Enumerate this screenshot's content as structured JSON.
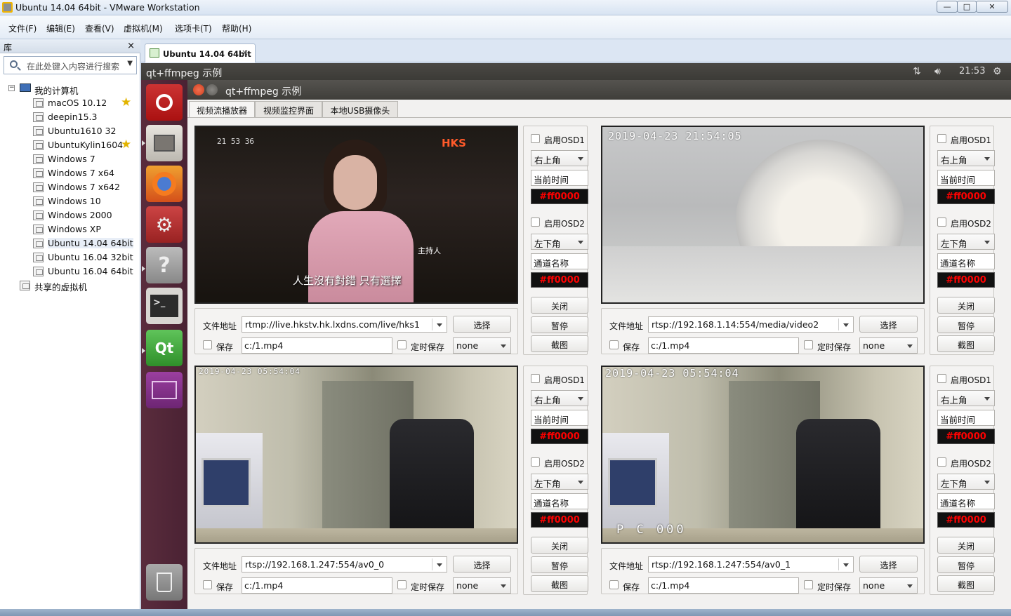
{
  "window": {
    "title": "Ubuntu 14.04 64bit - VMware Workstation"
  },
  "menu": [
    "文件(F)",
    "编辑(E)",
    "查看(V)",
    "虚拟机(M)",
    "选项卡(T)",
    "帮助(H)"
  ],
  "library": {
    "header": "库",
    "close": "×",
    "search_placeholder": "在此处键入内容进行搜索",
    "root": "我的计算机",
    "vms": [
      {
        "name": "macOS 10.12",
        "fav": true
      },
      {
        "name": "deepin15.3",
        "fav": false
      },
      {
        "name": "Ubuntu1610 32",
        "fav": false
      },
      {
        "name": "UbuntuKylin1604",
        "fav": true
      },
      {
        "name": "Windows 7",
        "fav": false
      },
      {
        "name": "Windows 7 x64",
        "fav": false
      },
      {
        "name": "Windows 7 x642",
        "fav": false
      },
      {
        "name": "Windows 10",
        "fav": false
      },
      {
        "name": "Windows 2000",
        "fav": false
      },
      {
        "name": "Windows XP",
        "fav": false
      },
      {
        "name": "Ubuntu 14.04 64bit",
        "fav": false,
        "selected": true
      },
      {
        "name": "Ubuntu 16.04 32bit",
        "fav": false
      },
      {
        "name": "Ubuntu 16.04 64bit",
        "fav": false
      }
    ],
    "shared": "共享的虚拟机"
  },
  "vm_tab": {
    "label": "Ubuntu 14.04 64bit",
    "close": "×"
  },
  "ubuntu_panel": {
    "title": "qt+ffmpeg 示例",
    "clock": "21:53"
  },
  "app": {
    "title": "qt+ffmpeg 示例",
    "tabs": [
      "视频流播放器",
      "视频监控界面",
      "本地USB摄像头"
    ],
    "active_tab": 0
  },
  "channels": [
    {
      "video_osd": "21 53 36",
      "video_logo": "HKS",
      "video_caption": "人生沒有對錯 只有選擇",
      "video_host_label": "主持人",
      "file_label": "文件地址",
      "url": "rtmp://live.hkstv.hk.lxdns.com/live/hks1",
      "select": "选择",
      "save_label": "保存",
      "save_path": "c:/1.mp4",
      "timed_save": "定时保存",
      "timed_value": "none",
      "osd1_label": "启用OSD1",
      "osd1_pos": "右上角",
      "osd1_text": "当前时间",
      "osd1_color": "#ff0000",
      "osd2_label": "启用OSD2",
      "osd2_pos": "左下角",
      "osd2_text": "通道名称",
      "osd2_color": "#ff0000",
      "close": "关闭",
      "pause": "暂停",
      "snapshot": "截图"
    },
    {
      "video_osd": "2019-04-23 21:54:05",
      "file_label": "文件地址",
      "url": "rtsp://192.168.1.14:554/media/video2",
      "select": "选择",
      "save_label": "保存",
      "save_path": "c:/1.mp4",
      "timed_save": "定时保存",
      "timed_value": "none",
      "osd1_label": "启用OSD1",
      "osd1_pos": "右上角",
      "osd1_text": "当前时间",
      "osd1_color": "#ff0000",
      "osd2_label": "启用OSD2",
      "osd2_pos": "左下角",
      "osd2_text": "通道名称",
      "osd2_color": "#ff0000",
      "close": "关闭",
      "pause": "暂停",
      "snapshot": "截图"
    },
    {
      "video_osd": "2019-04-23 05:54:04",
      "file_label": "文件地址",
      "url": "rtsp://192.168.1.247:554/av0_0",
      "select": "选择",
      "save_label": "保存",
      "save_path": "c:/1.mp4",
      "timed_save": "定时保存",
      "timed_value": "none",
      "osd1_label": "启用OSD1",
      "osd1_pos": "右上角",
      "osd1_text": "当前时间",
      "osd1_color": "#ff0000",
      "osd2_label": "启用OSD2",
      "osd2_pos": "左下角",
      "osd2_text": "通道名称",
      "osd2_color": "#ff0000",
      "close": "关闭",
      "pause": "暂停",
      "snapshot": "截图"
    },
    {
      "video_osd": "2019-04-23 05:54:04",
      "video_osd2": "P C 000",
      "file_label": "文件地址",
      "url": "rtsp://192.168.1.247:554/av0_1",
      "select": "选择",
      "save_label": "保存",
      "save_path": "c:/1.mp4",
      "timed_save": "定时保存",
      "timed_value": "none",
      "osd1_label": "启用OSD1",
      "osd1_pos": "右上角",
      "osd1_text": "当前时间",
      "osd1_color": "#ff0000",
      "osd2_label": "启用OSD2",
      "osd2_pos": "左下角",
      "osd2_text": "通道名称",
      "osd2_color": "#ff0000",
      "close": "关闭",
      "pause": "暂停",
      "snapshot": "截图"
    }
  ],
  "launcher": [
    "ubuntu-dash-icon",
    "files-icon",
    "firefox-icon",
    "system-settings-icon",
    "help-icon",
    "terminal-icon",
    "qt-creator-icon",
    "workspace-icon",
    "trash-icon"
  ],
  "colors": {
    "osd_color": "#ff0000",
    "launcher_bg": "#4f2536",
    "panel_bg": "#3c3b37"
  }
}
